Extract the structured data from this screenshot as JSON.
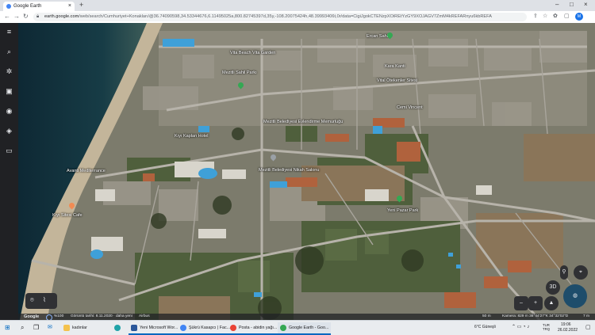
{
  "browser": {
    "tab_title": "Google Earth",
    "tab_close": "×",
    "new_tab": "+",
    "window_controls": [
      "–",
      "□",
      "×"
    ],
    "url_host": "earth.google.com",
    "url_path": "/web/search/Cumhuriyet+Konakları/@36.74090598,34.53344676,6.11495025a,800.82745397d,35y,-108.20075424h,48.39993406t,0r/data=CigiJgokCTENzpXOiREtYzGY9XOJAGV7ZmM4kREFARnyu6kbREFA",
    "profile_initial": "M",
    "nav": [
      "←",
      "→",
      "↻"
    ],
    "toolbar_icons": [
      "⇪",
      "☆",
      "✿",
      "▢"
    ]
  },
  "sidebar": {
    "icons": [
      "≡",
      "⌕",
      "✲",
      "▣",
      "◉",
      "◈",
      "▭"
    ]
  },
  "map": {
    "labels": [
      "Vita Beach Vita Garden",
      "Kara Kanti",
      "Mezitli Belediyesi Evlendirme Memurluğu",
      "Kıyı Kaplan Hotel",
      "Mezitli Belediyesi Nikah Salonu",
      "Avanti Mediterrance",
      "Cemi Vincent",
      "Yeni Pazar Park",
      "Vital Ötekenler Sitesi",
      "Kıyı Sitesi Cafe",
      "Mezitli Sahil Parkı",
      "Ercan Sahil"
    ],
    "compass_tilt": "3D",
    "zoom_out": "–",
    "zoom_in": "+"
  },
  "statusbar": {
    "brand": "Google",
    "zoom": "%100",
    "imagery_date": "Görüntü tarihi: 8.11.2020 · daha yeni",
    "provider": "Airbus",
    "scale": "50 m",
    "camera": "Kamera: 829 m   36°44'27\"K 34°32'02\"D",
    "elevation": "7 m"
  },
  "taskbar": {
    "search_label": "kadınlar",
    "apps": [
      {
        "label": "Yeni Microsoft Wor...",
        "color": "#2b579a"
      },
      {
        "label": "Şükrü Kasapcı | Fac...",
        "color": "#1877f2"
      },
      {
        "label": "Posta - abidin yağı...",
        "color": "#0078d4"
      },
      {
        "label": "Google Earth - Goo...",
        "color": "#1a73e8"
      }
    ],
    "weather": "6°C  Güneşli",
    "lang": "TUR\nTRQ",
    "time": "19:06",
    "date": "26.02.2022"
  }
}
